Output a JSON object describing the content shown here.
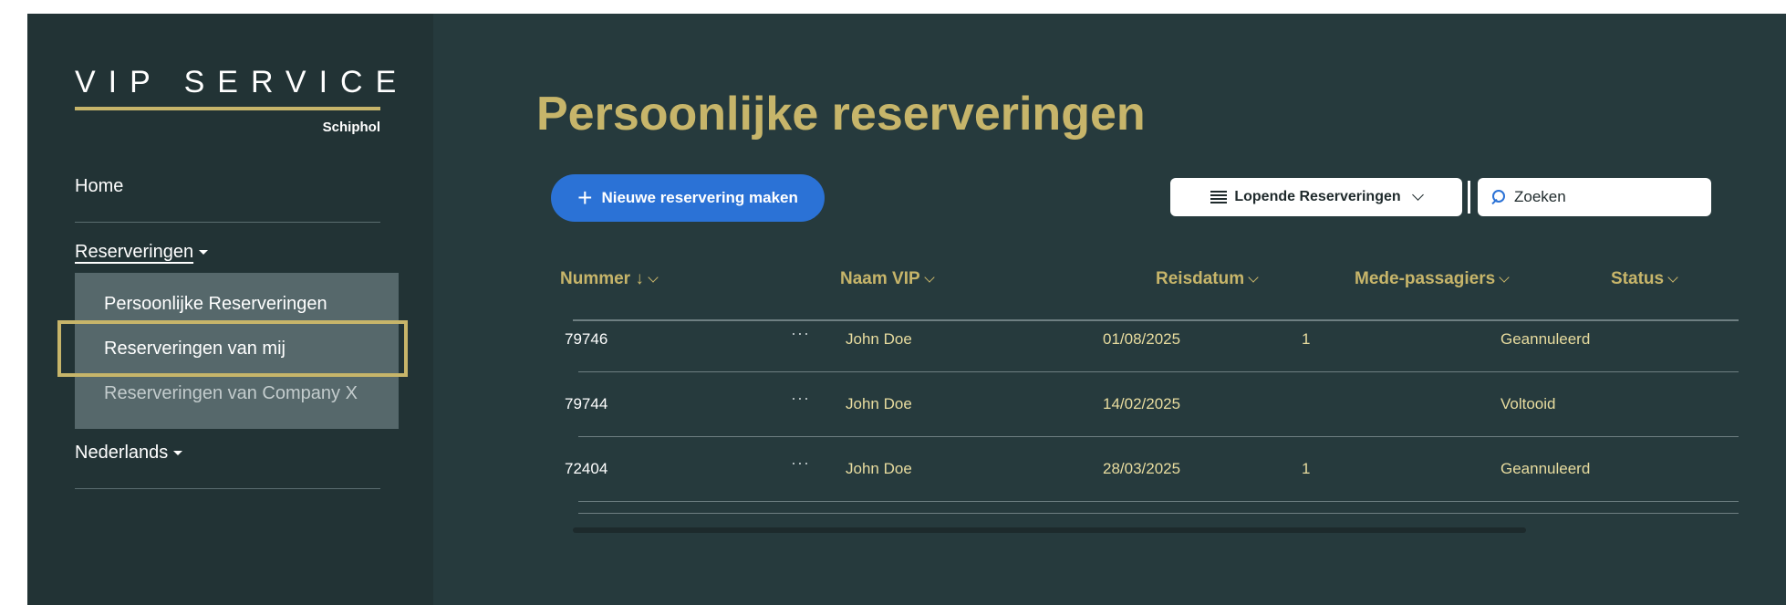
{
  "logo": {
    "title": "VIP SERVICE",
    "subtitle": "Schiphol"
  },
  "sidebar": {
    "home": "Home",
    "reserveringen": "Reserveringen",
    "submenu": [
      "Persoonlijke Reserveringen",
      "Reserveringen van mij",
      "Reserveringen van Company X"
    ],
    "language": "Nederlands"
  },
  "main": {
    "title": "Persoonlijke reserveringen",
    "new_button": "Nieuwe reservering maken",
    "filter_label": "Lopende Reserveringen",
    "search_placeholder": "Zoeken"
  },
  "table": {
    "columns": {
      "nummer": "Nummer ↓",
      "naam": "Naam VIP",
      "reisdatum": "Reisdatum",
      "mede": "Mede-passagiers",
      "status": "Status"
    },
    "rows": [
      {
        "nummer": "79746",
        "more": "···",
        "naam": "John Doe",
        "reisdatum": "01/08/2025",
        "mede": "1",
        "status": "Geannuleerd"
      },
      {
        "nummer": "79744",
        "more": "···",
        "naam": "John Doe",
        "reisdatum": "14/02/2025",
        "mede": "",
        "status": "Voltooid"
      },
      {
        "nummer": "72404",
        "more": "···",
        "naam": "John Doe",
        "reisdatum": "28/03/2025",
        "mede": "1",
        "status": "Geannuleerd"
      }
    ]
  },
  "colors": {
    "accent_gold": "#c7b56a",
    "primary_blue": "#2b72d6",
    "background": "#263a3d",
    "sidebar": "#223335"
  }
}
